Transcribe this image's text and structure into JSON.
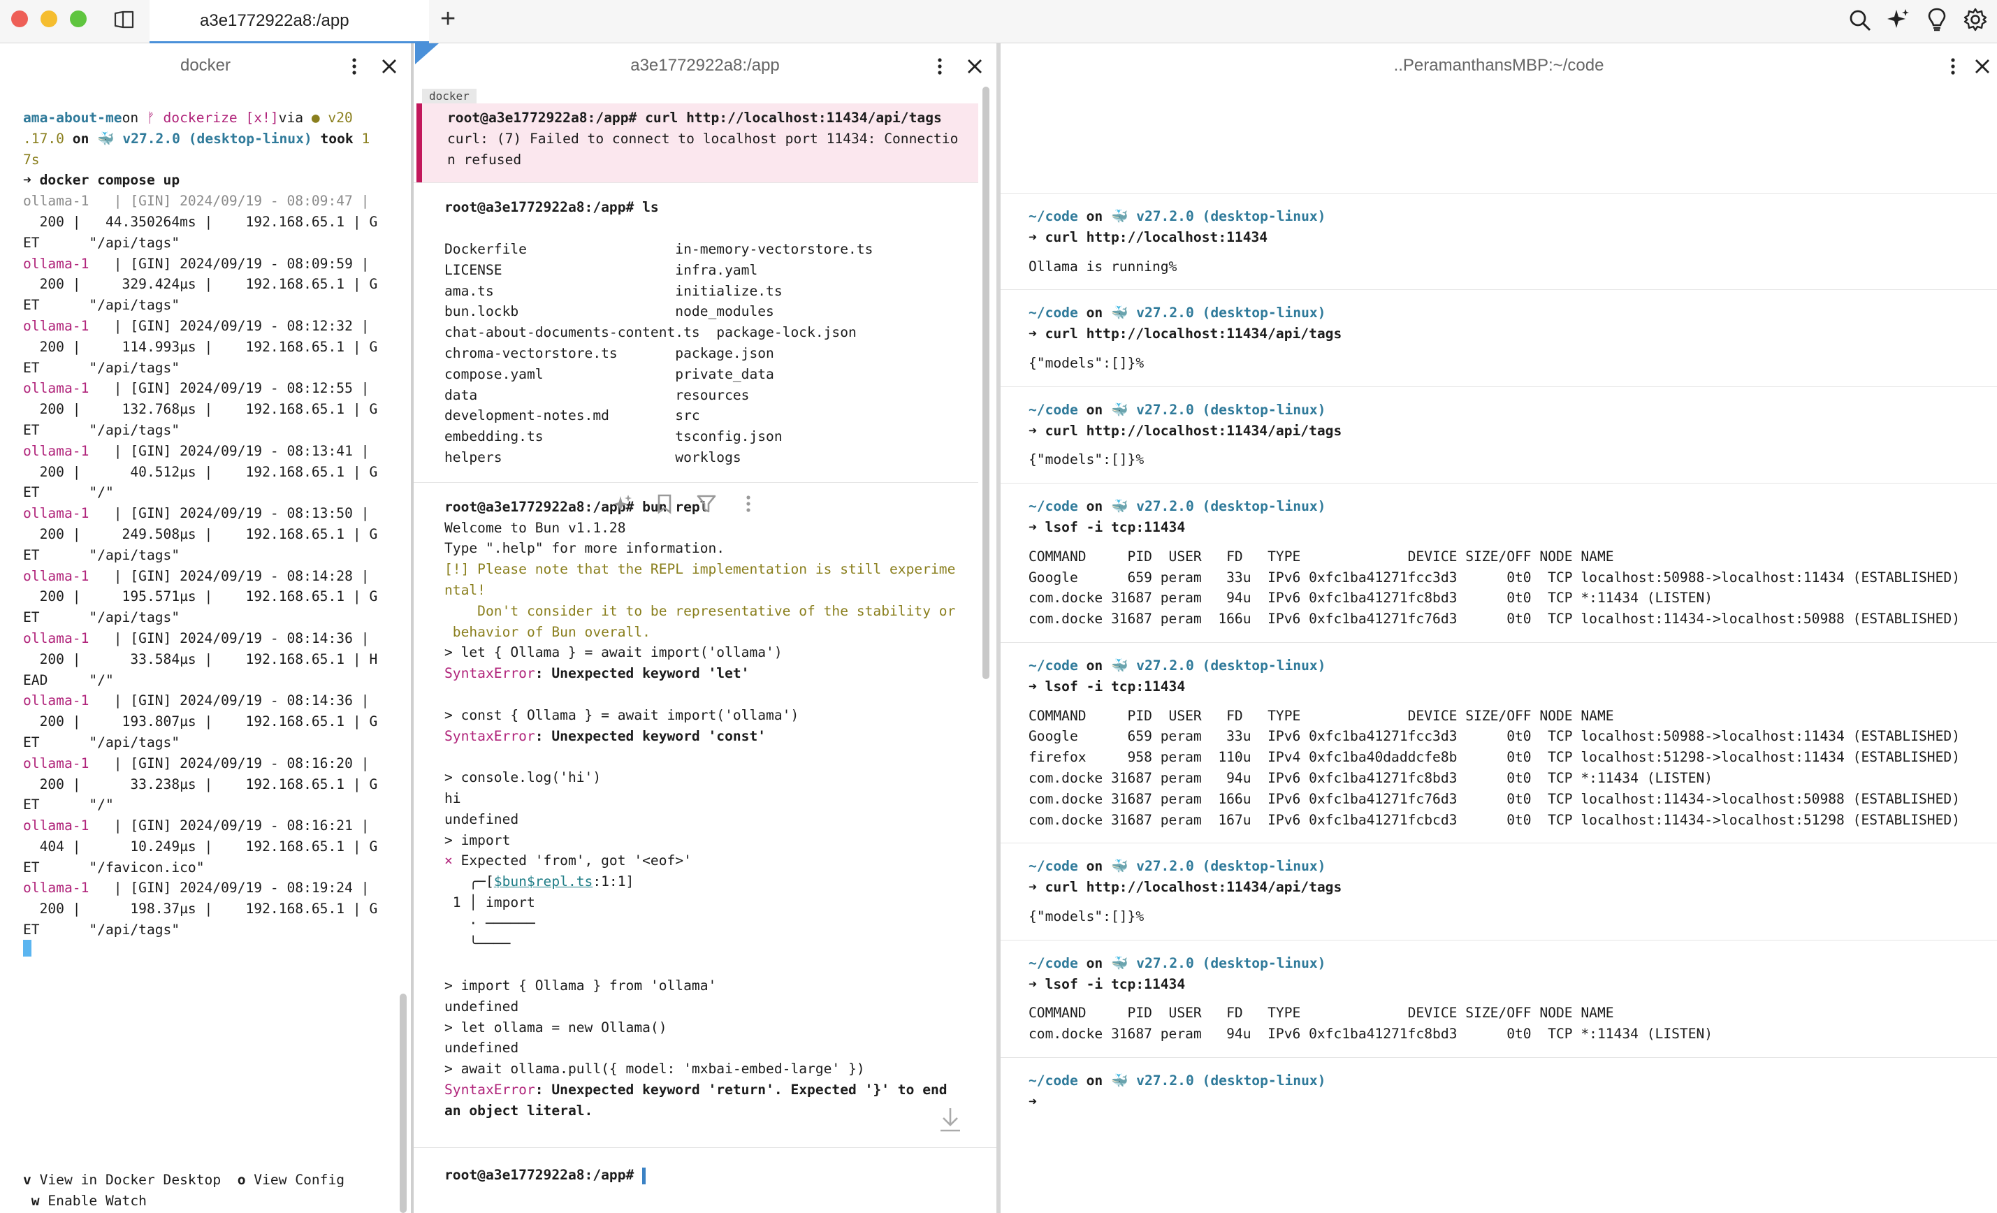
{
  "tabbar": {
    "tab_title": "a3e1772922a8:/app",
    "new_tab": "+"
  },
  "left": {
    "title": "docker",
    "lines": [
      {
        "seg": [
          [
            "cyan",
            "ama-about-me"
          ],
          [
            "",
            "on "
          ],
          [
            "mag",
            "ᚠ dockerize [x!]"
          ],
          [
            "",
            "via "
          ],
          [
            "olive",
            "● v20"
          ]
        ]
      },
      {
        "seg": [
          [
            "olive",
            ".17.0"
          ],
          [
            "bold",
            " on "
          ],
          [
            "cyan",
            "🐳 v27.2.0 (desktop-linux)"
          ],
          [
            "bold",
            " took "
          ],
          [
            "olive",
            "1"
          ]
        ]
      },
      {
        "seg": [
          [
            "olive",
            "7s"
          ]
        ]
      },
      {
        "seg": [
          [
            "bold",
            "➜ docker compose up"
          ]
        ]
      },
      {
        "seg": [
          [
            "grey",
            "ollama-1   | [GIN] 2024/09/19 - 08:09:47 |"
          ]
        ]
      },
      {
        "seg": [
          [
            "",
            "  200 |   44.350264ms |    192.168.65.1 | G"
          ]
        ]
      },
      {
        "seg": [
          [
            "",
            "ET      \"/api/tags\""
          ]
        ]
      },
      {
        "seg": [
          [
            "mag",
            "ollama-1"
          ],
          [
            "",
            "   | [GIN] 2024/09/19 - 08:09:59 |"
          ]
        ]
      },
      {
        "seg": [
          [
            "",
            "  200 |     329.424µs |    192.168.65.1 | G"
          ]
        ]
      },
      {
        "seg": [
          [
            "",
            "ET      \"/api/tags\""
          ]
        ]
      },
      {
        "seg": [
          [
            "mag",
            "ollama-1"
          ],
          [
            "",
            "   | [GIN] 2024/09/19 - 08:12:32 |"
          ]
        ]
      },
      {
        "seg": [
          [
            "",
            "  200 |     114.993µs |    192.168.65.1 | G"
          ]
        ]
      },
      {
        "seg": [
          [
            "",
            "ET      \"/api/tags\""
          ]
        ]
      },
      {
        "seg": [
          [
            "mag",
            "ollama-1"
          ],
          [
            "",
            "   | [GIN] 2024/09/19 - 08:12:55 |"
          ]
        ]
      },
      {
        "seg": [
          [
            "",
            "  200 |     132.768µs |    192.168.65.1 | G"
          ]
        ]
      },
      {
        "seg": [
          [
            "",
            "ET      \"/api/tags\""
          ]
        ]
      },
      {
        "seg": [
          [
            "mag",
            "ollama-1"
          ],
          [
            "",
            "   | [GIN] 2024/09/19 - 08:13:41 |"
          ]
        ]
      },
      {
        "seg": [
          [
            "",
            "  200 |      40.512µs |    192.168.65.1 | G"
          ]
        ]
      },
      {
        "seg": [
          [
            "",
            "ET      \"/\""
          ]
        ]
      },
      {
        "seg": [
          [
            "mag",
            "ollama-1"
          ],
          [
            "",
            "   | [GIN] 2024/09/19 - 08:13:50 |"
          ]
        ]
      },
      {
        "seg": [
          [
            "",
            "  200 |     249.508µs |    192.168.65.1 | G"
          ]
        ]
      },
      {
        "seg": [
          [
            "",
            "ET      \"/api/tags\""
          ]
        ]
      },
      {
        "seg": [
          [
            "mag",
            "ollama-1"
          ],
          [
            "",
            "   | [GIN] 2024/09/19 - 08:14:28 |"
          ]
        ]
      },
      {
        "seg": [
          [
            "",
            "  200 |     195.571µs |    192.168.65.1 | G"
          ]
        ]
      },
      {
        "seg": [
          [
            "",
            "ET      \"/api/tags\""
          ]
        ]
      },
      {
        "seg": [
          [
            "mag",
            "ollama-1"
          ],
          [
            "",
            "   | [GIN] 2024/09/19 - 08:14:36 |"
          ]
        ]
      },
      {
        "seg": [
          [
            "",
            "  200 |      33.584µs |    192.168.65.1 | H"
          ]
        ]
      },
      {
        "seg": [
          [
            "",
            "EAD     \"/\""
          ]
        ]
      },
      {
        "seg": [
          [
            "mag",
            "ollama-1"
          ],
          [
            "",
            "   | [GIN] 2024/09/19 - 08:14:36 |"
          ]
        ]
      },
      {
        "seg": [
          [
            "",
            "  200 |     193.807µs |    192.168.65.1 | G"
          ]
        ]
      },
      {
        "seg": [
          [
            "",
            "ET      \"/api/tags\""
          ]
        ]
      },
      {
        "seg": [
          [
            "mag",
            "ollama-1"
          ],
          [
            "",
            "   | [GIN] 2024/09/19 - 08:16:20 |"
          ]
        ]
      },
      {
        "seg": [
          [
            "",
            "  200 |      33.238µs |    192.168.65.1 | G"
          ]
        ]
      },
      {
        "seg": [
          [
            "",
            "ET      \"/\""
          ]
        ]
      },
      {
        "seg": [
          [
            "mag",
            "ollama-1"
          ],
          [
            "",
            "   | [GIN] 2024/09/19 - 08:16:21 |"
          ]
        ]
      },
      {
        "seg": [
          [
            "",
            "  404 |      10.249µs |    192.168.65.1 | G"
          ]
        ]
      },
      {
        "seg": [
          [
            "",
            "ET      \"/favicon.ico\""
          ]
        ]
      },
      {
        "seg": [
          [
            "mag",
            "ollama-1"
          ],
          [
            "",
            "   | [GIN] 2024/09/19 - 08:19:24 |"
          ]
        ]
      },
      {
        "seg": [
          [
            "",
            "  200 |      198.37µs |    192.168.65.1 | G"
          ]
        ]
      },
      {
        "seg": [
          [
            "",
            "ET      \"/api/tags\""
          ]
        ]
      }
    ],
    "footer1": [
      [
        "bold",
        "v"
      ],
      [
        "",
        " View in Docker Desktop  "
      ],
      [
        "bold",
        "o"
      ],
      [
        "",
        " View Config"
      ]
    ],
    "footer2": [
      [
        "bold",
        " w"
      ],
      [
        "",
        " Enable Watch"
      ]
    ]
  },
  "middle": {
    "title": "a3e1772922a8:/app",
    "badge": "docker",
    "blocks": [
      {
        "error": true,
        "lines": [
          [
            [
              "bold",
              "root@a3e1772922a8:/app# curl http://localhost:11434/api/tags"
            ]
          ],
          [
            [
              "",
              "curl: (7) Failed to connect to localhost port 11434: Connectio"
            ]
          ],
          [
            [
              "",
              "n refused"
            ]
          ]
        ]
      },
      {
        "lines": [
          [
            [
              "bold",
              "root@a3e1772922a8:/app# ls"
            ]
          ],
          [
            [
              "",
              ""
            ]
          ],
          [
            [
              "",
              "Dockerfile                  in-memory-vectorstore.ts"
            ]
          ],
          [
            [
              "",
              "LICENSE                     infra.yaml"
            ]
          ],
          [
            [
              "",
              "ama.ts                      initialize.ts"
            ]
          ],
          [
            [
              "",
              "bun.lockb                   node_modules"
            ]
          ],
          [
            [
              "",
              "chat-about-documents-content.ts  package-lock.json"
            ]
          ],
          [
            [
              "",
              "chroma-vectorstore.ts       package.json"
            ]
          ],
          [
            [
              "",
              "compose.yaml                private_data"
            ]
          ],
          [
            [
              "",
              "data                        resources"
            ]
          ],
          [
            [
              "",
              "development-notes.md        src"
            ]
          ],
          [
            [
              "",
              "embedding.ts                tsconfig.json"
            ]
          ],
          [
            [
              "",
              "helpers                     worklogs"
            ]
          ]
        ]
      },
      {
        "lines": [
          [
            [
              "bold",
              "root@a3e1772922a8:/app# bun repl"
            ]
          ],
          [
            [
              "",
              "Welcome to Bun v1.1.28"
            ]
          ],
          [
            [
              "",
              "Type \".help\" for more information."
            ]
          ],
          [
            [
              "olive",
              "[!] Please note that the REPL implementation is still experime"
            ]
          ],
          [
            [
              "olive",
              "ntal!"
            ]
          ],
          [
            [
              "olive",
              "    Don't consider it to be representative of the stability or"
            ]
          ],
          [
            [
              "olive",
              " behavior of Bun overall."
            ]
          ],
          [
            [
              "",
              "> let { Ollama } = await import('ollama')"
            ]
          ],
          [
            [
              "mag",
              "SyntaxError"
            ],
            [
              "bold",
              ": Unexpected keyword 'let'"
            ]
          ],
          [
            [
              "",
              ""
            ]
          ],
          [
            [
              "",
              "> const { Ollama } = await import('ollama')"
            ]
          ],
          [
            [
              "mag",
              "SyntaxError"
            ],
            [
              "bold",
              ": Unexpected keyword 'const'"
            ]
          ],
          [
            [
              "",
              ""
            ]
          ],
          [
            [
              "",
              "> console.log('hi')"
            ]
          ],
          [
            [
              "",
              "hi"
            ]
          ],
          [
            [
              "",
              "undefined"
            ]
          ],
          [
            [
              "",
              "> import"
            ]
          ],
          [
            [
              "mag",
              "×"
            ],
            [
              "",
              " Expected 'from', got '<eof>'"
            ]
          ],
          [
            [
              "",
              "   ╭─["
            ],
            [
              "teal",
              "$bun$repl.ts"
            ],
            [
              "",
              ":1:1]"
            ]
          ],
          [
            [
              "",
              " 1 │ import"
            ]
          ],
          [
            [
              "",
              "   · ──────"
            ]
          ],
          [
            [
              "",
              "   ╰────"
            ]
          ],
          [
            [
              "",
              ""
            ]
          ],
          [
            [
              "",
              "> import { Ollama } from 'ollama'"
            ]
          ],
          [
            [
              "",
              "undefined"
            ]
          ],
          [
            [
              "",
              "> let ollama = new Ollama()"
            ]
          ],
          [
            [
              "",
              "undefined"
            ]
          ],
          [
            [
              "",
              "> await ollama.pull({ model: 'mxbai-embed-large' })"
            ]
          ],
          [
            [
              "mag",
              "SyntaxError"
            ],
            [
              "bold",
              ": Unexpected keyword 'return'. Expected '}' to end"
            ]
          ],
          [
            [
              "bold",
              "an object literal."
            ]
          ]
        ]
      }
    ],
    "prompt": "root@a3e1772922a8:/app# "
  },
  "right": {
    "title": "..PeramanthansMBP:~/code",
    "blocks": [
      {
        "cmd": "➜ curl http://localhost:11434",
        "out": [
          "Ollama is running%"
        ]
      },
      {
        "cmd": "➜ curl http://localhost:11434/api/tags",
        "out": [
          "{\"models\":[]}%"
        ]
      },
      {
        "cmd": "➜ curl http://localhost:11434/api/tags",
        "out": [
          "{\"models\":[]}%"
        ]
      },
      {
        "cmd": "➜ lsof -i tcp:11434",
        "out": [
          "COMMAND     PID  USER   FD   TYPE             DEVICE SIZE/OFF NODE NAME",
          "Google      659 peram   33u  IPv6 0xfc1ba41271fcc3d3      0t0  TCP localhost:50988->localhost:11434 (ESTABLISHED)",
          "com.docke 31687 peram   94u  IPv6 0xfc1ba41271fc8bd3      0t0  TCP *:11434 (LISTEN)",
          "com.docke 31687 peram  166u  IPv6 0xfc1ba41271fc76d3      0t0  TCP localhost:11434->localhost:50988 (ESTABLISHED)"
        ]
      },
      {
        "cmd": "➜ lsof -i tcp:11434",
        "out": [
          "COMMAND     PID  USER   FD   TYPE             DEVICE SIZE/OFF NODE NAME",
          "Google      659 peram   33u  IPv6 0xfc1ba41271fcc3d3      0t0  TCP localhost:50988->localhost:11434 (ESTABLISHED)",
          "firefox     958 peram  110u  IPv4 0xfc1ba40daddcfe8b      0t0  TCP localhost:51298->localhost:11434 (ESTABLISHED)",
          "com.docke 31687 peram   94u  IPv6 0xfc1ba41271fc8bd3      0t0  TCP *:11434 (LISTEN)",
          "com.docke 31687 peram  166u  IPv6 0xfc1ba41271fc76d3      0t0  TCP localhost:11434->localhost:50988 (ESTABLISHED)",
          "com.docke 31687 peram  167u  IPv6 0xfc1ba41271fcbcd3      0t0  TCP localhost:11434->localhost:51298 (ESTABLISHED)"
        ]
      },
      {
        "cmd": "➜ curl http://localhost:11434/api/tags",
        "out": [
          "{\"models\":[]}%"
        ]
      },
      {
        "cmd": "➜ lsof -i tcp:11434",
        "out": [
          "COMMAND     PID  USER   FD   TYPE             DEVICE SIZE/OFF NODE NAME",
          "com.docke 31687 peram   94u  IPv6 0xfc1ba41271fc8bd3      0t0  TCP *:11434 (LISTEN)"
        ]
      }
    ],
    "path": "~/code",
    "on": " on ",
    "docker": "🐳 v27.2.0 (desktop-linux)",
    "final_prompt": "➜"
  }
}
